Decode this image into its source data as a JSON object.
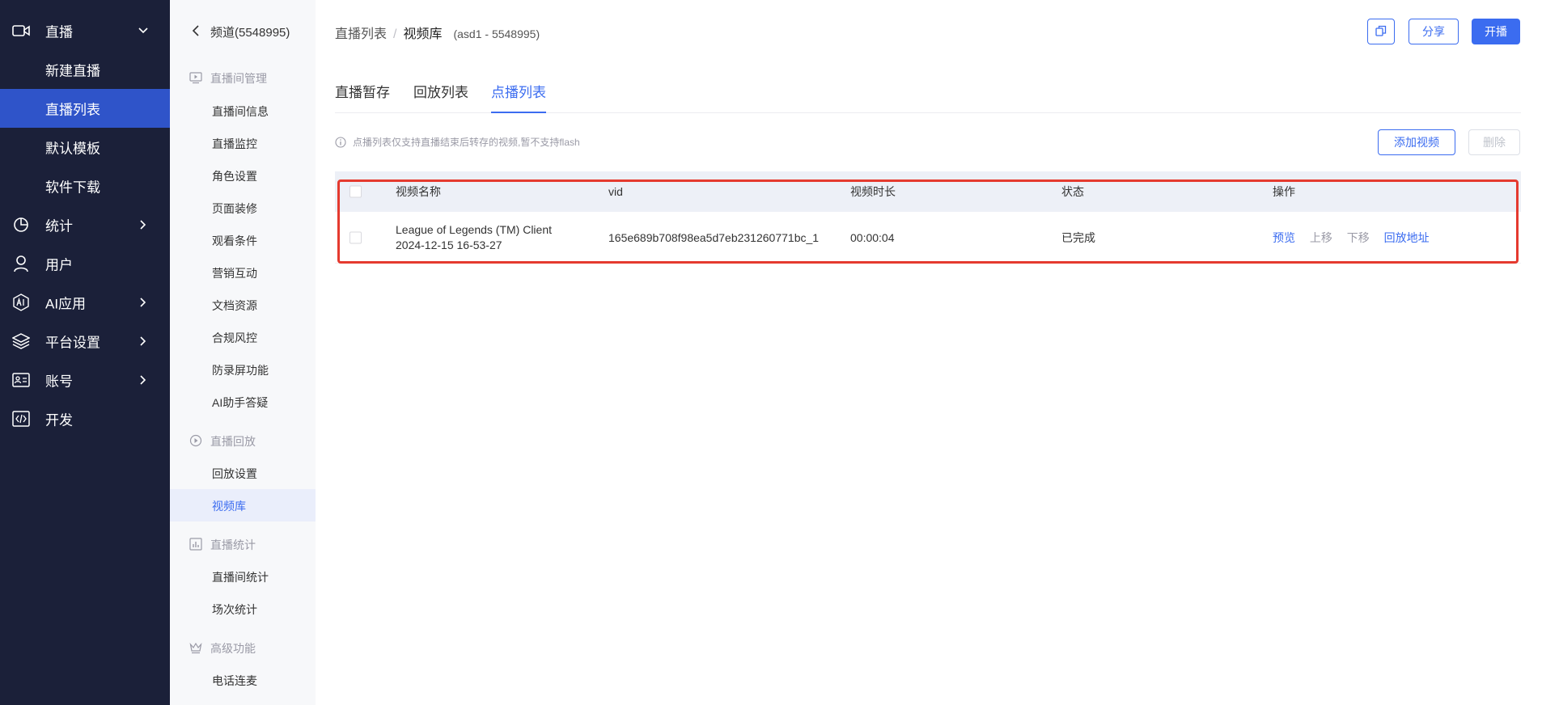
{
  "nav": {
    "items": [
      {
        "label": "直播"
      },
      {
        "label": "统计"
      },
      {
        "label": "用户"
      },
      {
        "label": "AI应用"
      },
      {
        "label": "平台设置"
      },
      {
        "label": "账号"
      },
      {
        "label": "开发"
      }
    ],
    "live_sub": [
      {
        "label": "新建直播"
      },
      {
        "label": "直播列表",
        "active": true
      },
      {
        "label": "默认模板"
      },
      {
        "label": "软件下载"
      }
    ]
  },
  "submenu": {
    "back_label": "频道(5548995)",
    "groups": [
      {
        "label": "直播间管理",
        "items": [
          "直播间信息",
          "直播监控",
          "角色设置",
          "页面装修",
          "观看条件",
          "营销互动",
          "文档资源",
          "合规风控",
          "防录屏功能",
          "AI助手答疑"
        ]
      },
      {
        "label": "直播回放",
        "items": [
          "回放设置",
          "视频库"
        ]
      },
      {
        "label": "直播统计",
        "items": [
          "直播间统计",
          "场次统计"
        ]
      },
      {
        "label": "高级功能",
        "items": [
          "电话连麦"
        ]
      }
    ],
    "active_item": "视频库"
  },
  "header": {
    "breadcrumb": [
      "直播列表",
      "视频库"
    ],
    "breadcrumb_sep": "/",
    "channel_meta": "(asd1 - 5548995)",
    "share_label": "分享",
    "live_label": "开播"
  },
  "tabs": [
    {
      "label": "直播暂存"
    },
    {
      "label": "回放列表"
    },
    {
      "label": "点播列表",
      "active": true
    }
  ],
  "notice": "点播列表仅支持直播结束后转存的视频,暂不支持flash",
  "toolbar": {
    "add_label": "添加视频",
    "delete_label": "删除"
  },
  "table": {
    "columns": [
      "视频名称",
      "vid",
      "视频时长",
      "状态",
      "操作"
    ],
    "rows": [
      {
        "name_line1": "League of Legends (TM) Client",
        "name_line2": "2024-12-15 16-53-27",
        "vid": "165e689b708f98ea5d7eb231260771bc_1",
        "duration": "00:00:04",
        "status": "已完成",
        "ops": [
          {
            "label": "预览",
            "style": "primary"
          },
          {
            "label": "上移",
            "style": "muted"
          },
          {
            "label": "下移",
            "style": "muted"
          },
          {
            "label": "回放地址",
            "style": "primary"
          }
        ]
      }
    ]
  },
  "colors": {
    "accent": "#3b6cf0",
    "nav_bg": "#1b2039",
    "nav_active": "#2f54c9",
    "highlight": "#e53a2f"
  }
}
